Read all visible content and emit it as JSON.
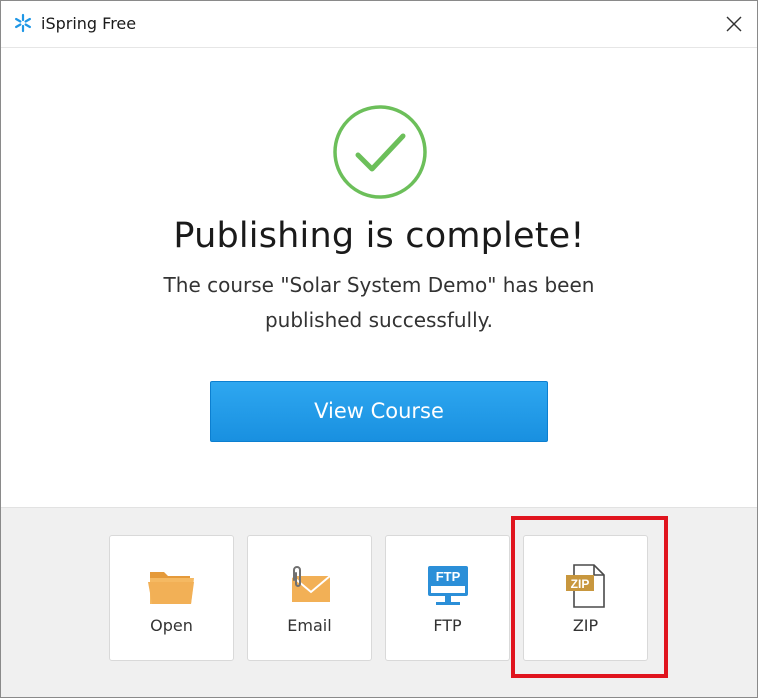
{
  "window": {
    "title": "iSpring Free",
    "app_icon": "ispring-snowflake-icon",
    "close_icon": "close-icon"
  },
  "main": {
    "status_icon": "check-circle-icon",
    "headline": "Publishing is complete!",
    "message_line1": "The course \"Solar System Demo\" has been",
    "message_line2": "published successfully.",
    "primary_button": "View Course"
  },
  "actions": [
    {
      "id": "open",
      "label": "Open",
      "icon": "folder-icon"
    },
    {
      "id": "email",
      "label": "Email",
      "icon": "envelope-attachment-icon"
    },
    {
      "id": "ftp",
      "label": "FTP",
      "icon": "ftp-monitor-icon",
      "icon_text": "FTP"
    },
    {
      "id": "zip",
      "label": "ZIP",
      "icon": "zip-file-icon",
      "icon_text": "ZIP"
    }
  ],
  "colors": {
    "accent_blue": "#1f97e6",
    "success_green": "#6cbf5a",
    "folder_orange": "#f2b056",
    "ftp_blue": "#2b8fd8",
    "zip_gold": "#c8973e",
    "highlight_red": "#e0141e"
  }
}
